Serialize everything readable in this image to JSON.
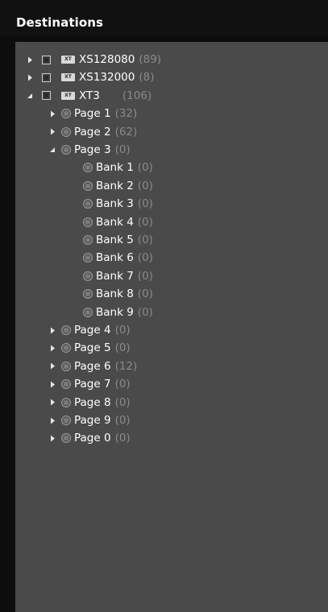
{
  "panel": {
    "title": "Destinations"
  },
  "tree": [
    {
      "label": "XS128080",
      "count": "(89)",
      "type": "device",
      "expanded": false
    },
    {
      "label": "XS132000",
      "count": "(8)",
      "type": "device",
      "expanded": false
    },
    {
      "label": "XT3",
      "count": "(106)",
      "type": "device",
      "expanded": true,
      "children": [
        {
          "label": "Page 1",
          "count": "(32)",
          "expanded": false
        },
        {
          "label": "Page 2",
          "count": "(62)",
          "expanded": false
        },
        {
          "label": "Page 3",
          "count": "(0)",
          "expanded": true,
          "children": [
            {
              "label": "Bank 1",
              "count": "(0)"
            },
            {
              "label": "Bank 2",
              "count": "(0)"
            },
            {
              "label": "Bank 3",
              "count": "(0)"
            },
            {
              "label": "Bank 4",
              "count": "(0)"
            },
            {
              "label": "Bank 5",
              "count": "(0)"
            },
            {
              "label": "Bank 6",
              "count": "(0)"
            },
            {
              "label": "Bank 7",
              "count": "(0)"
            },
            {
              "label": "Bank 8",
              "count": "(0)"
            },
            {
              "label": "Bank 9",
              "count": "(0)"
            }
          ]
        },
        {
          "label": "Page 4",
          "count": "(0)",
          "expanded": false
        },
        {
          "label": "Page 5",
          "count": "(0)",
          "expanded": false
        },
        {
          "label": "Page 6",
          "count": "(12)",
          "expanded": false
        },
        {
          "label": "Page 7",
          "count": "(0)",
          "expanded": false
        },
        {
          "label": "Page 8",
          "count": "(0)",
          "expanded": false
        },
        {
          "label": "Page 9",
          "count": "(0)",
          "expanded": false
        },
        {
          "label": "Page 0",
          "count": "(0)",
          "expanded": false
        }
      ]
    }
  ],
  "icons": {
    "device": "xt-device-icon",
    "node": "radio-icon",
    "expand": "triangle-right-icon",
    "collapse": "triangle-down-icon"
  },
  "colors": {
    "background": "#0d0d0d",
    "tree_bg": "#4a4a4a",
    "text": "#ffffff",
    "count": "#8a8a8a"
  }
}
